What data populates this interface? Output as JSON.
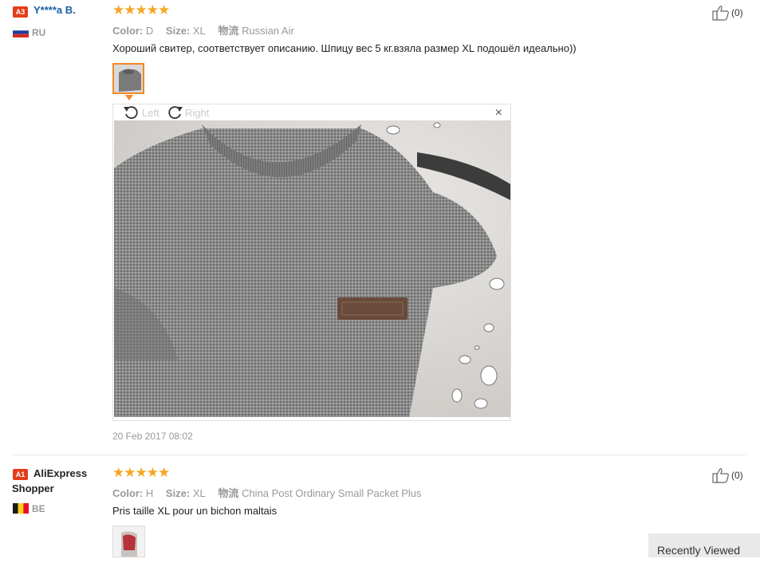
{
  "reviews": [
    {
      "badge": "A3",
      "name": "Y****a B.",
      "country": "RU",
      "stars": "★★★★★",
      "color_label": "Color:",
      "color_value": "D",
      "size_label": "Size:",
      "size_value": "XL",
      "shipping_label": "物流",
      "shipping_value": "Russian Air",
      "text": "Хороший свитер, соответствует описанию. Шпицу вес 5 кг.взяла размер XL подошёл идеально))",
      "likes": "(0)",
      "date": "20 Feb 2017 08:02"
    },
    {
      "badge": "A1",
      "name": "AliExpress Shopper",
      "country": "BE",
      "stars": "★★★★★",
      "color_label": "Color:",
      "color_value": "H",
      "size_label": "Size:",
      "size_value": "XL",
      "shipping_label": "物流",
      "shipping_value": "China Post Ordinary Small Packet Plus",
      "text": "Pris taille XL pour un bichon maltais",
      "likes": "(0)"
    }
  ],
  "viewer": {
    "left_label": "Left",
    "right_label": "Right",
    "close": "×"
  },
  "recently_viewed": "Recently Viewed",
  "colors": {
    "badge": "#e43c1a",
    "stars": "#f5a623",
    "name_link": "#1a5ea8",
    "thumb_selected_border": "#f08a24"
  }
}
